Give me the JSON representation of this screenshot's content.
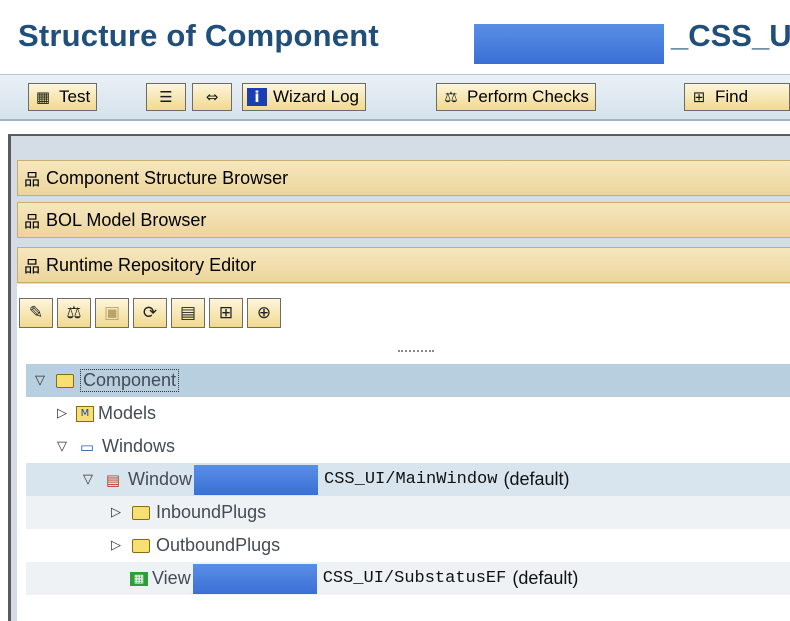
{
  "title": {
    "prefix": "Structure of Component",
    "suffix": "_CSS_U"
  },
  "toolbar": {
    "test_label": "Test",
    "wizard_log_label": "Wizard Log",
    "perform_checks_label": "Perform Checks",
    "find_label": "Find"
  },
  "trays": {
    "component_structure_browser": "Component Structure Browser",
    "bol_model_browser": "BOL Model Browser",
    "runtime_repository_editor": "Runtime Repository Editor"
  },
  "tree": {
    "component": "Component",
    "models": "Models",
    "windows": "Windows",
    "window_prefix": "Window",
    "window_suffix": "CSS_UI/MainWindow",
    "window_default": "(default)",
    "inbound_plugs": "InboundPlugs",
    "outbound_plugs": "OutboundPlugs",
    "view_prefix": "View",
    "view_suffix": "CSS_UI/SubstatusEF",
    "view_default": "(default)"
  },
  "colors": {
    "title": "#1f4f7a",
    "tray": "#f1dfa8",
    "redaction": "#4a7fe0",
    "tree_selected": "#b8cfe0"
  }
}
